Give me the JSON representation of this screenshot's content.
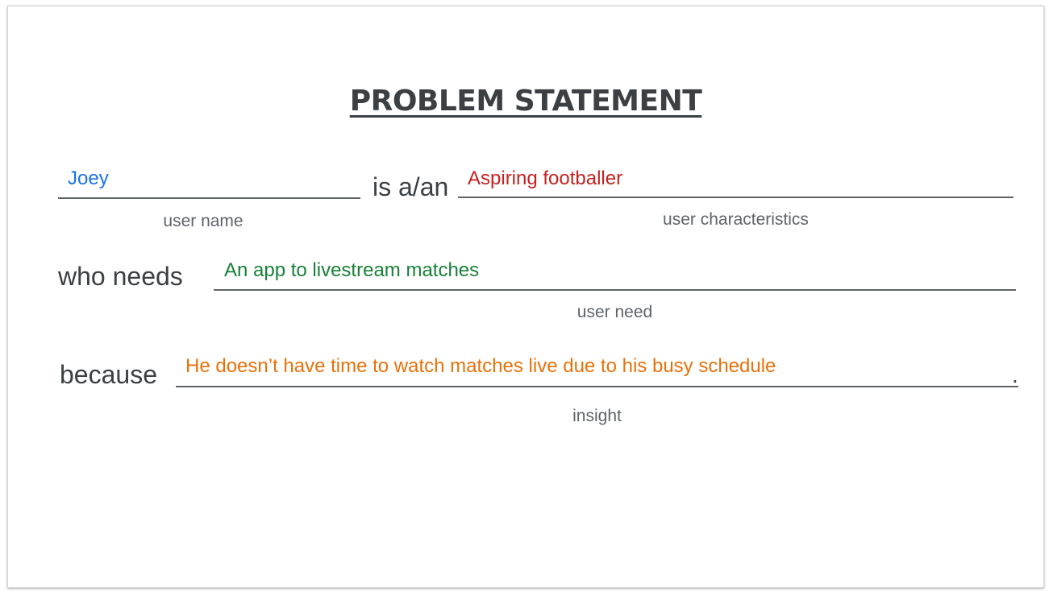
{
  "title": "PROBLEM STATEMENT",
  "row1": {
    "user_name_value": "Joey",
    "user_name_caption": "user name",
    "connector": "is a/an",
    "characteristics_value": "Aspiring footballer",
    "characteristics_caption": "user characteristics"
  },
  "row2": {
    "lead": "who needs",
    "need_value": "An app to livestream matches",
    "need_caption": "user need"
  },
  "row3": {
    "lead": "because",
    "insight_value": "He doesn’t have time to watch matches live due to his busy schedule",
    "insight_caption": "insight",
    "end_punctuation": "."
  },
  "colors": {
    "user_name": "#1a73e8",
    "characteristics": "#c5221f",
    "need": "#188038",
    "insight": "#e8710a",
    "text": "#3c4043",
    "caption": "#5f6368",
    "line": "#5f6368"
  }
}
